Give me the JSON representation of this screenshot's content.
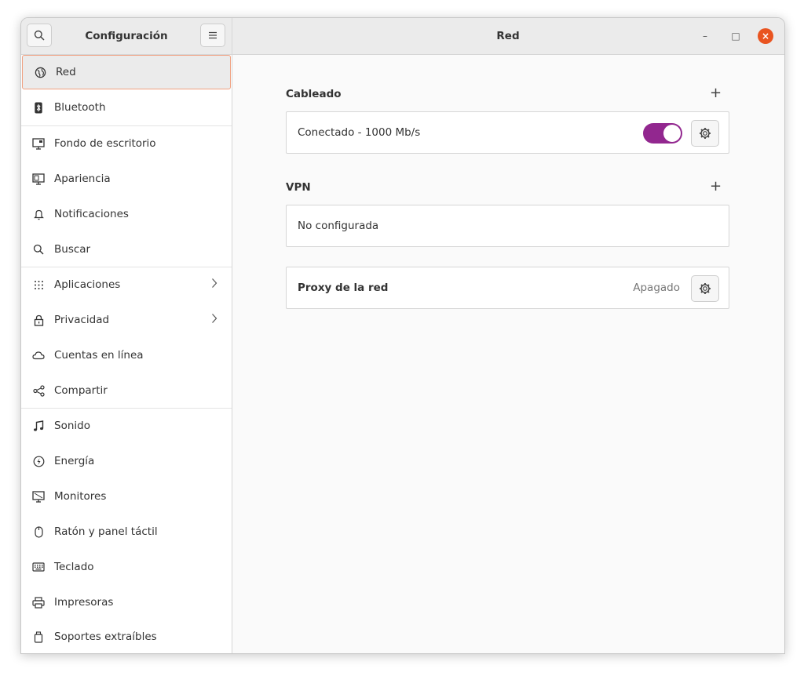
{
  "header": {
    "sidebar_title": "Configuración",
    "page_title": "Red",
    "search_icon": "search-icon",
    "menu_icon": "hamburger-menu-icon"
  },
  "window_controls": {
    "minimize": "–",
    "maximize": "□",
    "close": "×"
  },
  "sidebar": {
    "items": [
      {
        "label": "Red",
        "icon": "network-globe-icon",
        "selected": true
      },
      {
        "label": "Bluetooth",
        "icon": "bluetooth-icon"
      },
      {
        "label": "Fondo de escritorio",
        "icon": "desktop-background-icon"
      },
      {
        "label": "Apariencia",
        "icon": "appearance-icon"
      },
      {
        "label": "Notificaciones",
        "icon": "bell-icon"
      },
      {
        "label": "Buscar",
        "icon": "search-icon"
      },
      {
        "label": "Aplicaciones",
        "icon": "apps-grid-icon",
        "has_submenu": true
      },
      {
        "label": "Privacidad",
        "icon": "lock-icon",
        "has_submenu": true
      },
      {
        "label": "Cuentas en línea",
        "icon": "cloud-icon"
      },
      {
        "label": "Compartir",
        "icon": "share-icon"
      },
      {
        "label": "Sonido",
        "icon": "music-note-icon"
      },
      {
        "label": "Energía",
        "icon": "power-icon"
      },
      {
        "label": "Monitores",
        "icon": "monitor-icon"
      },
      {
        "label": "Ratón y panel táctil",
        "icon": "mouse-icon"
      },
      {
        "label": "Teclado",
        "icon": "keyboard-icon"
      },
      {
        "label": "Impresoras",
        "icon": "printer-icon"
      },
      {
        "label": "Soportes extraíbles",
        "icon": "removable-media-icon"
      }
    ]
  },
  "main": {
    "wired": {
      "title": "Cableado",
      "add_label": "+",
      "status": "Conectado - 1000 Mb/s",
      "toggle_on": true
    },
    "vpn": {
      "title": "VPN",
      "add_label": "+",
      "status": "No configurada"
    },
    "proxy": {
      "label": "Proxy de la red",
      "status": "Apagado"
    }
  },
  "colors": {
    "accent_toggle": "#92278f",
    "close_button": "#e95420",
    "selection_border": "#f0a080"
  }
}
